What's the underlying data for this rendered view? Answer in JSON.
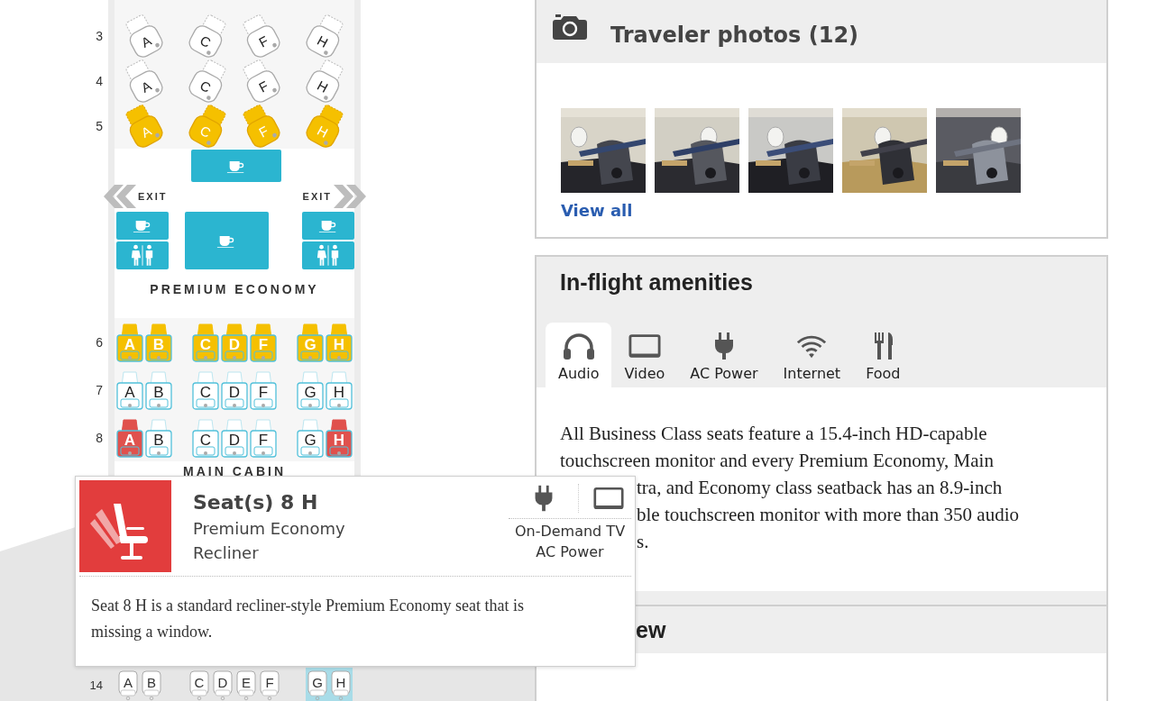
{
  "seat_map": {
    "sections": [
      {
        "kind": "business",
        "number": "3",
        "groups": [
          {
            "seats": [
              {
                "letter": "A",
                "color": "#ffffff"
              }
            ]
          },
          {
            "seats": [
              {
                "letter": "C",
                "color": "#ffffff"
              },
              {
                "letter": "F",
                "color": "#ffffff"
              }
            ]
          },
          {
            "seats": [
              {
                "letter": "H",
                "color": "#ffffff"
              }
            ]
          }
        ]
      },
      {
        "kind": "business",
        "number": "4",
        "groups": [
          {
            "seats": [
              {
                "letter": "A",
                "color": "#ffffff"
              }
            ]
          },
          {
            "seats": [
              {
                "letter": "C",
                "color": "#ffffff"
              },
              {
                "letter": "F",
                "color": "#ffffff"
              }
            ]
          },
          {
            "seats": [
              {
                "letter": "H",
                "color": "#ffffff"
              }
            ]
          }
        ]
      },
      {
        "kind": "business",
        "number": "5",
        "groups": [
          {
            "seats": [
              {
                "letter": "A",
                "color": "#f5c000"
              }
            ]
          },
          {
            "seats": [
              {
                "letter": "C",
                "color": "#f5c000"
              },
              {
                "letter": "F",
                "color": "#f5c000"
              }
            ]
          },
          {
            "seats": [
              {
                "letter": "H",
                "color": "#f5c000"
              }
            ]
          }
        ]
      },
      {
        "kind": "galley",
        "exits": [
          "EXIT",
          "EXIT"
        ]
      },
      {
        "kind": "label",
        "text": "PREMIUM ECONOMY"
      },
      {
        "kind": "premium",
        "number": "6",
        "groups": [
          {
            "seats": [
              {
                "letter": "A",
                "color": "#f5c000"
              },
              {
                "letter": "B",
                "color": "#f5c000"
              }
            ]
          },
          {
            "seats": [
              {
                "letter": "C",
                "color": "#f5c000"
              },
              {
                "letter": "D",
                "color": "#f5c000"
              },
              {
                "letter": "F",
                "color": "#f5c000"
              }
            ]
          },
          {
            "seats": [
              {
                "letter": "G",
                "color": "#f5c000"
              },
              {
                "letter": "H",
                "color": "#f5c000"
              }
            ]
          }
        ]
      },
      {
        "kind": "premium",
        "number": "7",
        "groups": [
          {
            "seats": [
              {
                "letter": "A",
                "color": "#ffffff"
              },
              {
                "letter": "B",
                "color": "#ffffff"
              }
            ]
          },
          {
            "seats": [
              {
                "letter": "C",
                "color": "#ffffff"
              },
              {
                "letter": "D",
                "color": "#ffffff"
              },
              {
                "letter": "F",
                "color": "#ffffff"
              }
            ]
          },
          {
            "seats": [
              {
                "letter": "G",
                "color": "#ffffff"
              },
              {
                "letter": "H",
                "color": "#ffffff"
              }
            ]
          }
        ]
      },
      {
        "kind": "premium",
        "number": "8",
        "groups": [
          {
            "seats": [
              {
                "letter": "A",
                "color": "#e0514d"
              },
              {
                "letter": "B",
                "color": "#ffffff"
              }
            ]
          },
          {
            "seats": [
              {
                "letter": "C",
                "color": "#ffffff"
              },
              {
                "letter": "D",
                "color": "#ffffff"
              },
              {
                "letter": "F",
                "color": "#ffffff"
              }
            ]
          },
          {
            "seats": [
              {
                "letter": "G",
                "color": "#ffffff"
              },
              {
                "letter": "H",
                "color": "#e0514d"
              }
            ]
          }
        ]
      },
      {
        "kind": "label",
        "text": "MAIN CABIN"
      }
    ],
    "below_popup": [
      {
        "kind": "main",
        "number": "14",
        "groups": [
          {
            "seats": [
              {
                "letter": "A",
                "color": "#ffffff",
                "selected": false
              },
              {
                "letter": "B",
                "color": "#ffffff",
                "selected": false
              }
            ]
          },
          {
            "seats": [
              {
                "letter": "C",
                "color": "#ffffff",
                "selected": false
              },
              {
                "letter": "D",
                "color": "#ffffff",
                "selected": false
              },
              {
                "letter": "E",
                "color": "#ffffff",
                "selected": false
              },
              {
                "letter": "F",
                "color": "#ffffff",
                "selected": false
              }
            ]
          },
          {
            "seats": [
              {
                "letter": "G",
                "color": "#ffffff",
                "selected": true
              },
              {
                "letter": "H",
                "color": "#ffffff",
                "selected": true
              }
            ]
          }
        ]
      }
    ]
  },
  "popup": {
    "title": "Seat(s) 8 H",
    "seat_class": "Premium Economy",
    "seat_type": "Recliner",
    "features": [
      "On-Demand TV",
      "AC Power"
    ],
    "description": "Seat 8 H is a standard recliner-style Premium Economy seat that is missing a window."
  },
  "photos_panel": {
    "title": "Traveler photos (12)",
    "link": "View all"
  },
  "amenities_panel": {
    "title": "In-flight amenities",
    "tabs": [
      {
        "label": "Audio",
        "selected": true
      },
      {
        "label": "Video",
        "selected": false
      },
      {
        "label": "AC Power",
        "selected": false
      },
      {
        "label": "Internet",
        "selected": false
      },
      {
        "label": "Food",
        "selected": false
      }
    ],
    "text_lines": [
      {
        "kind": "full",
        "text": "All Business Class seats feature a 15.4-inch HD-capable"
      },
      {
        "kind": "full",
        "text": "touchscreen monitor and every Premium Economy, Main"
      },
      {
        "kind": "cut",
        "text": "tra, and Economy class seatback has an 8.9-inch"
      },
      {
        "kind": "cut",
        "text": "ble touchscreen monitor with more than 350 audio"
      },
      {
        "kind": "cut",
        "text": "s."
      }
    ]
  },
  "next_panel": {
    "title": "ew"
  }
}
